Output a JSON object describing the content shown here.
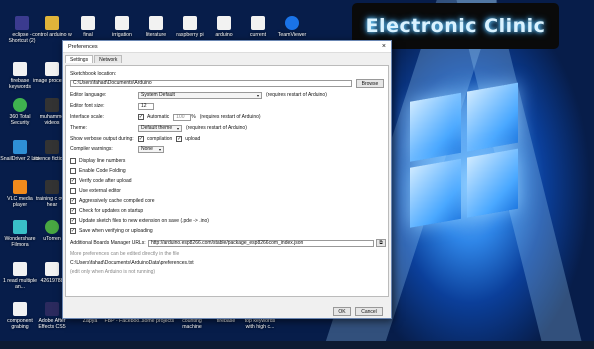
{
  "brand": {
    "label": "Electronic Clinic"
  },
  "desktop_icons": [
    {
      "label": "eclipse - Shortcut (2)",
      "color": "#3b3b8f"
    },
    {
      "label": "control arduino w",
      "color": "#e0b43a"
    },
    {
      "label": "final",
      "color": "#f2f2f2"
    },
    {
      "label": "irrigation",
      "color": "#f2f2f2"
    },
    {
      "label": "literature",
      "color": "#f2f2f2"
    },
    {
      "label": "raspberry pi",
      "color": "#f2f2f2"
    },
    {
      "label": "arduino",
      "color": "#f2f2f2"
    },
    {
      "label": "current",
      "color": "#f2f2f2"
    },
    {
      "label": "TeamViewer",
      "color": "#1a73e8"
    },
    {
      "label": "firebase keywords",
      "color": "#f2f2f2"
    },
    {
      "label": "image processin",
      "color": "#f2f2f2"
    },
    {
      "label": "360 Total Security",
      "color": "#3fb34f"
    },
    {
      "label": "muhamme videos",
      "color": "#333333"
    },
    {
      "label": "SnailDriver 2 Lite",
      "color": "#2e8fd6"
    },
    {
      "label": "science fiction st",
      "color": "#333333"
    },
    {
      "label": "VLC media player",
      "color": "#f08a1c"
    },
    {
      "label": "training c own hear",
      "color": "#333333"
    },
    {
      "label": "Wondershare Filmora",
      "color": "#39c0c8"
    },
    {
      "label": "uTorren",
      "color": "#48a742"
    },
    {
      "label": "1 read multiple an...",
      "color": "#f2f2f2"
    },
    {
      "label": "42619788",
      "color": "#f2f2f2"
    },
    {
      "label": "component grabing",
      "color": "#f2f2f2"
    },
    {
      "label": "Adobe After Effects CS5",
      "color": "#2b2a5e"
    },
    {
      "label": "Zapya",
      "color": "#2b2b2b"
    },
    {
      "label": "FBP - Faceboo...",
      "color": "#2b2b2b"
    },
    {
      "label": "some projects",
      "color": "#2b2b2b"
    },
    {
      "label": "counting machine",
      "color": "#2b2b2b"
    },
    {
      "label": "firebase",
      "color": "#2b2b2b"
    },
    {
      "label": "top keywords with high c...",
      "color": "#2b2b2b"
    }
  ],
  "dialog": {
    "title": "Preferences",
    "close_glyph": "×",
    "tabs": [
      "Settings",
      "Network"
    ],
    "sketchbook_label": "Sketchbook location:",
    "sketchbook_path": "C:\\Users\\fahad\\Documents\\Arduino",
    "browse_label": "Browse",
    "editor_language_label": "Editor language:",
    "editor_language_value": "System Default",
    "restart_note": "(requires restart of Arduino)",
    "font_size_label": "Editor font size:",
    "font_size_value": "12",
    "interface_scale_label": "Interface scale:",
    "automatic_label": "Automatic",
    "scale_value": "100",
    "percent": "%",
    "theme_label": "Theme:",
    "theme_value": "Default theme",
    "verbose_label": "Show verbose output during:",
    "compilation_label": "compilation",
    "upload_label": "upload",
    "warnings_label": "Compiler warnings:",
    "warnings_value": "None",
    "options": [
      {
        "label": "Display line numbers",
        "checked": false
      },
      {
        "label": "Enable Code Folding",
        "checked": false
      },
      {
        "label": "Verify code after upload",
        "checked": true
      },
      {
        "label": "Use external editor",
        "checked": false
      },
      {
        "label": "Aggressively cache compiled core",
        "checked": true
      },
      {
        "label": "Check for updates on startup",
        "checked": true
      },
      {
        "label": "Update sketch files to new extension on save (.pde -> .ino)",
        "checked": true
      },
      {
        "label": "Save when verifying or uploading",
        "checked": true
      }
    ],
    "boards_label": "Additional Boards Manager URLs:",
    "boards_url": "http://arduino.esp8266.com/stable/package_esp8266com_index.json",
    "prefs_note": "More preferences can be edited directly in the file",
    "prefs_path": "C:\\Users\\fahad\\Documents\\ArduinoData\\preferences.txt",
    "edit_note": "(edit only when Arduino is not running)",
    "ok_label": "OK",
    "cancel_label": "Cancel"
  }
}
